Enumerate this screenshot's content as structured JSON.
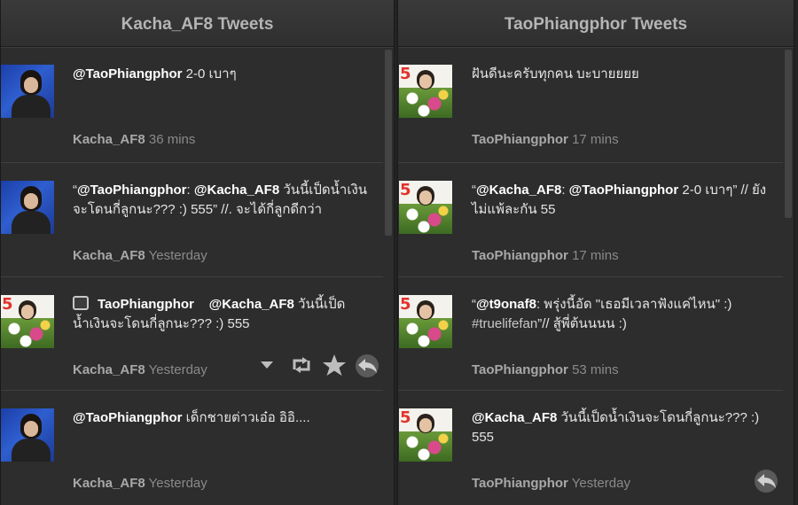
{
  "columns": [
    {
      "header": "Kacha_AF8 Tweets",
      "tweets": [
        {
          "mention": "@TaoPhiangphor",
          "text": " 2-0 เบาๆ",
          "user": "Kacha_AF8",
          "time": "36 mins",
          "avatar": "kacha-avatar"
        },
        {
          "text_a": "“",
          "mention": "@TaoPhiangphor",
          "text_b": ": ",
          "mention2": "@Kacha_AF8",
          "text_c": " วันนี้เป็ดน้ำเงินจะโดนกี่ลูกนะ??? :) 555” //. จะได้กี่ลูกดีกว่า",
          "user": "Kacha_AF8",
          "time": "Yesterday",
          "avatar": "kacha-avatar"
        },
        {
          "retweet_user": "TaoPhiangphor",
          "mention": "@Kacha_AF8",
          "text": " วันนี้เป็ดน้ำเงินจะโดนกี่ลูกนะ??? :) 555",
          "user": "Kacha_AF8",
          "time": "Yesterday",
          "avatar": "tao-avatar",
          "actions": [
            "dropdown-icon",
            "retweet-icon",
            "star-icon",
            "reply-icon"
          ]
        },
        {
          "mention": "@TaoPhiangphor",
          "text": " เด็กชายต่าวเอ๋อ อิอิ....",
          "user": "Kacha_AF8",
          "time": "Yesterday",
          "avatar": "kacha-avatar"
        }
      ]
    },
    {
      "header": "TaoPhiangphor Tweets",
      "tweets": [
        {
          "text": "ฝันดีนะครับทุกคน บะบายยยย",
          "user": "TaoPhiangphor",
          "time": "17 mins",
          "avatar": "tao-avatar"
        },
        {
          "text_a": "“",
          "mention": "@Kacha_AF8",
          "text_b": ": ",
          "mention2": "@TaoPhiangphor",
          "text_c": " 2-0 เบาๆ” // ยังไม่แพ้ละกัน 55",
          "user": "TaoPhiangphor",
          "time": "17 mins",
          "avatar": "tao-avatar"
        },
        {
          "text_a": "“",
          "mention": "@t9onaf8",
          "text_b": ": พรุ่งนี้อัด \"เธอมีเวลาฟังแค่ไหน\" :) ",
          "hashtag": "#truelifefan",
          "text_c": "”// สู้พี่ต้นนนน :)",
          "user": "TaoPhiangphor",
          "time": "53 mins",
          "avatar": "tao-avatar"
        },
        {
          "mention": "@Kacha_AF8",
          "text": " วันนี้เป็ดน้ำเงินจะโดนกี่ลูกนะ??? :) 555",
          "user": "TaoPhiangphor",
          "time": "Yesterday",
          "avatar": "tao-avatar",
          "actions": [
            "reply-icon"
          ]
        }
      ]
    }
  ],
  "magazine_number": "5",
  "colors": {
    "background": "#2d2d2d",
    "text": "#e5e5e5",
    "meta": "#8a8a8a"
  }
}
